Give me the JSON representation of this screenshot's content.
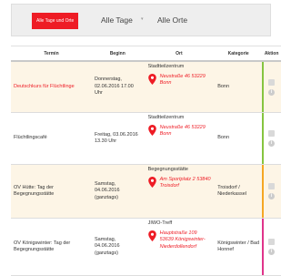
{
  "filter": {
    "all_button_label": "Alle Tage und Orte",
    "days_select": "Alle Tage",
    "places_select": "Alle Orte"
  },
  "table": {
    "headers": [
      "Termin",
      "Beginn",
      "Ort",
      "Kategorie",
      "Aktion"
    ],
    "rows": [
      {
        "termin": "Deutschkurs für Flüchtlinge",
        "beginn": "Donnerstag, 02.06.2016 17.00 Uhr",
        "venue": "Stadtteilzentrum",
        "address": "Neustraße 46 53229 Bonn",
        "kategorie": "Bonn",
        "stripe_color": "#86c440"
      },
      {
        "termin": "Flüchtlingscafé",
        "beginn": "Freitag, 03.06.2016 13.30 Uhr",
        "venue": "Stadtteilzentrum",
        "address": "Neustraße 46 53229 Bonn",
        "kategorie": "Bonn",
        "stripe_color": "#86c440"
      },
      {
        "termin": "OV Hütte: Tag der Begegnungsstätte",
        "beginn": "Samstag, 04.06.2016 (ganztags)",
        "venue": "Begegnungsstätte",
        "address": "Am Sportplatz 2 53840 Troisdorf",
        "kategorie": "Troisdorf / Niederkassel",
        "stripe_color": "#f5a623"
      },
      {
        "termin": "OV Königswinter: Tag der Begegnungsstätte",
        "beginn": "Samstag, 04.06.2016 (ganztags)",
        "venue": "JIWO-Treff",
        "address": "Hauptstraße 109 53639 Königswinter-Niederdollendorf",
        "kategorie": "Königswinter / Bad Honnef",
        "stripe_color": "#e0348a"
      }
    ]
  },
  "colors": {
    "accent": "#ee1c25",
    "row_alt": "#fdf5e6"
  },
  "icons": {
    "pin": "map-pin-icon",
    "document": "document-icon",
    "info": "info-icon"
  }
}
